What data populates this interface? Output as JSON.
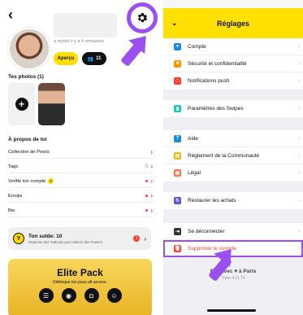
{
  "profile": {
    "joined": "a rejoint il y a 4 semaines",
    "apercu_label": "Aperçu",
    "friends_count": "11",
    "photos_title": "Tes photos (1)",
    "about_title": "À propos de toi",
    "rows": [
      {
        "label": "Collection de Pixels",
        "value": "",
        "dot": false,
        "check": false
      },
      {
        "label": "Tags",
        "value": "5",
        "dot": false,
        "check": false
      },
      {
        "label": "Verifie ton compte",
        "value": "",
        "dot": true,
        "check": true
      },
      {
        "label": "Emojis",
        "value": "",
        "dot": true,
        "check": false
      },
      {
        "label": "Bio",
        "value": "",
        "dot": true,
        "check": false
      }
    ],
    "solde_title": "Ton solde: 10",
    "solde_sub": "Dépense des YuBucks pour obtenir des Powers.",
    "solde_badge": "1",
    "elite_title": "Elite Pack",
    "elite_sub": "Débloque ton pass all-access."
  },
  "settings": {
    "title": "Réglages",
    "groups": [
      [
        {
          "label": "Compte",
          "icon": "user-icon",
          "color": "#1e88e5"
        },
        {
          "label": "Sécurité et confidentialité",
          "icon": "lock-icon",
          "color": "#ff9500"
        },
        {
          "label": "Notifications push",
          "icon": "bell-icon",
          "color": "#ff3b30"
        }
      ],
      [
        {
          "label": "Paramètres des Swipes",
          "icon": "swipe-icon",
          "color": "#1ec8b4"
        }
      ],
      [
        {
          "label": "Aide",
          "icon": "help-icon",
          "color": "#1e88e5"
        },
        {
          "label": "Règlement de la Communauté",
          "icon": "rules-icon",
          "color": "#ffb300"
        },
        {
          "label": "Légal",
          "icon": "legal-icon",
          "color": "#ff7043"
        }
      ],
      [
        {
          "label": "Restaurer les achats",
          "icon": "restore-icon",
          "color": "#5856d6"
        }
      ],
      [
        {
          "label": "Se déconnecter",
          "icon": "logout-icon",
          "color": "#333333"
        },
        {
          "label": "Supprimer le compte",
          "icon": "trash-icon",
          "color": "#ff3b30"
        }
      ]
    ],
    "footer_made": "Fait avec ♥ à Paris",
    "footer_version": "Yubo 4.11.74"
  }
}
